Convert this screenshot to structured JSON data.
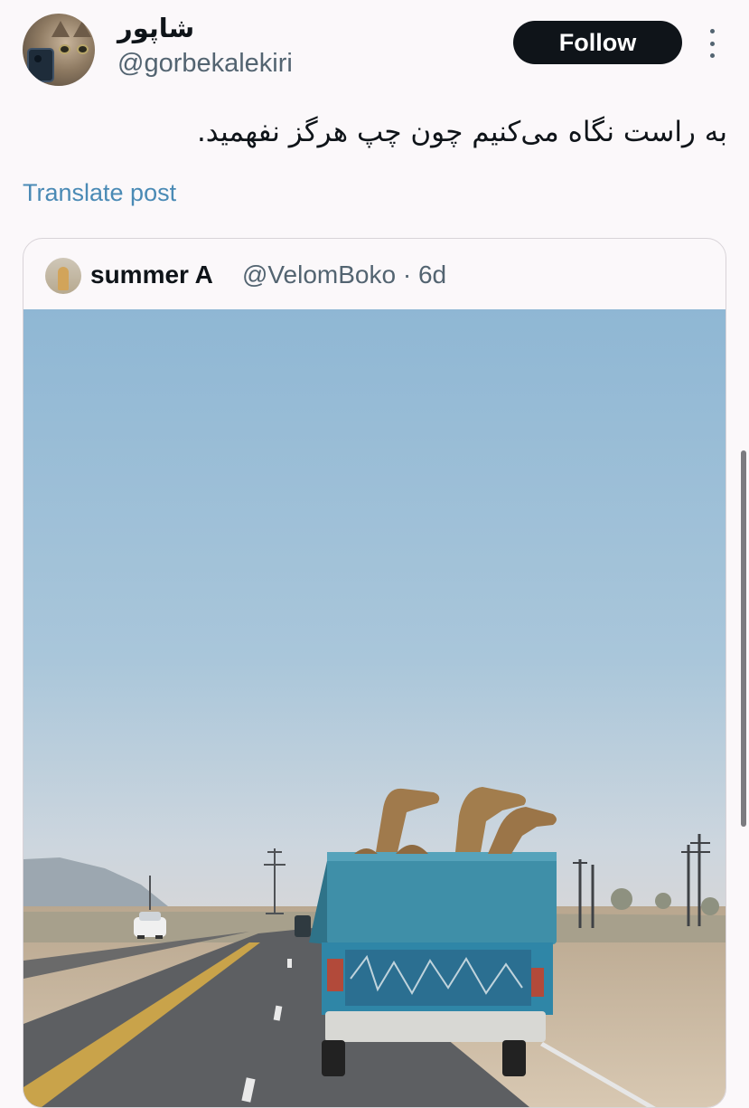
{
  "post": {
    "author": {
      "display_name": "شاپور",
      "handle": "@gorbekalekiri"
    },
    "follow_label": "Follow",
    "text": "به راست نگاه می‌کنیم چون چپ هرگز نفهمید.",
    "translate_label": "Translate post"
  },
  "quoted_post": {
    "author_name": "summer A",
    "handle": "@VelomBoko",
    "separator": "·",
    "time": "6d",
    "image_description_icon": "photo"
  },
  "colors": {
    "follow_button_bg": "#0f1419",
    "link": "#4a8ab5",
    "secondary_text": "#536471"
  },
  "icons": {
    "more": "more-vertical-icon"
  }
}
